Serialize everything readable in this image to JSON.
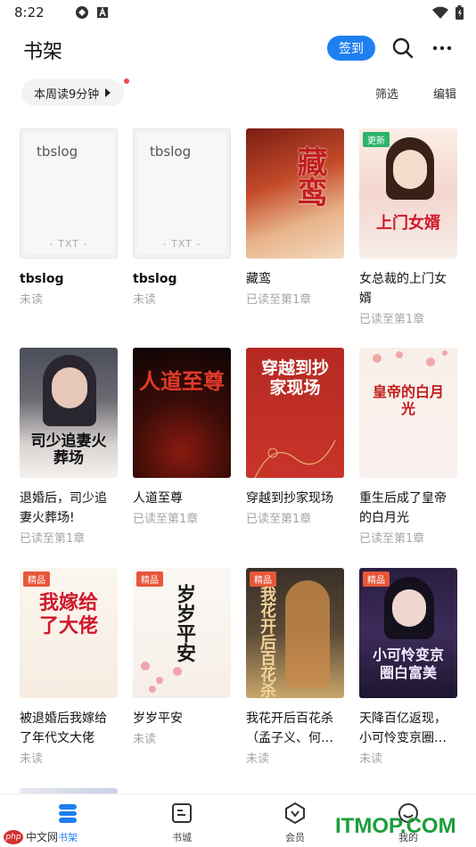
{
  "status_bar": {
    "time": "8:22"
  },
  "header": {
    "title": "书架",
    "checkin_label": "签到"
  },
  "toolbar": {
    "reading_time": "本周读9分钟",
    "filter_label": "筛选",
    "edit_label": "编辑"
  },
  "books": [
    {
      "title": "tbslog",
      "status": "未读",
      "cover_type": "txt",
      "cover_name": "tbslog",
      "cover_ext": "- TXT -"
    },
    {
      "title": "tbslog",
      "status": "未读",
      "cover_type": "txt",
      "cover_name": "tbslog",
      "cover_ext": "- TXT -"
    },
    {
      "title": "藏鸾",
      "status": "已读至第1章",
      "cover_text": "藏鸾"
    },
    {
      "title": "女总裁的上门女婿",
      "status": "已读至第1章",
      "badge": "更新",
      "cover_text": "上门女婿"
    },
    {
      "title": "退婚后，司少追妻火葬场!",
      "status": "已读至第1章",
      "cover_text": "司少追妻火葬场"
    },
    {
      "title": "人道至尊",
      "status": "已读至第1章",
      "cover_text": "人道至尊"
    },
    {
      "title": "穿越到抄家现场",
      "status": "已读至第1章",
      "cover_text": "穿越到抄家现场"
    },
    {
      "title": "重生后成了皇帝的白月光",
      "status": "已读至第1章",
      "cover_text": "皇帝的白月光"
    },
    {
      "title": "被退婚后我嫁给了年代文大佬",
      "status": "未读",
      "badge": "精品",
      "cover_text": "我嫁给了大佬"
    },
    {
      "title": "岁岁平安",
      "status": "未读",
      "badge": "精品",
      "cover_text": "岁岁平安"
    },
    {
      "title": "我花开后百花杀（孟子义、何…",
      "status": "未读",
      "badge": "精品",
      "cover_text": "我花开后百花杀"
    },
    {
      "title": "天降百亿返现，小可怜变京圈…",
      "status": "未读",
      "badge": "精品",
      "cover_text": "小可怜变京圈白富美"
    }
  ],
  "tabs": [
    {
      "label": "书架",
      "icon": "bookshelf-icon",
      "active": true
    },
    {
      "label": "书城",
      "icon": "bookstore-icon"
    },
    {
      "label": "会员",
      "icon": "vip-icon"
    },
    {
      "label": "我的",
      "icon": "profile-icon"
    }
  ],
  "watermarks": {
    "left": "中文网",
    "left_logo": "php",
    "right": "ITMOP.COM"
  },
  "colors": {
    "accent": "#1f7ff0",
    "badge_update": "#2db36a",
    "badge_premium": "#e8563a",
    "watermark_green": "#1c9e3a"
  }
}
